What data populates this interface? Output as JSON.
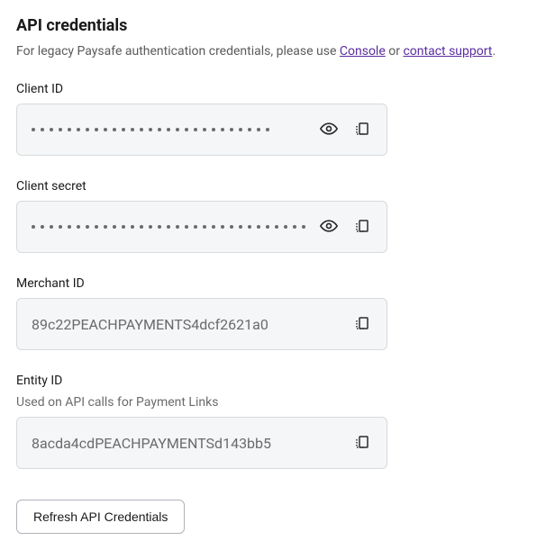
{
  "heading": "API credentials",
  "description": {
    "prefix": "For legacy Paysafe authentication credentials, please use ",
    "link1": "Console",
    "middle": " or ",
    "link2": "contact support",
    "suffix": "."
  },
  "fields": {
    "clientId": {
      "label": "Client ID",
      "masked": true,
      "dotCount": 27
    },
    "clientSecret": {
      "label": "Client secret",
      "masked": true,
      "dotCount": 31
    },
    "merchantId": {
      "label": "Merchant ID",
      "value": "89c22PEACHPAYMENTS4dcf2621a0"
    },
    "entityId": {
      "label": "Entity ID",
      "sublabel": "Used on API calls for Payment Links",
      "value": "8acda4cdPEACHPAYMENTSd143bb5"
    }
  },
  "refreshButton": "Refresh API Credentials"
}
